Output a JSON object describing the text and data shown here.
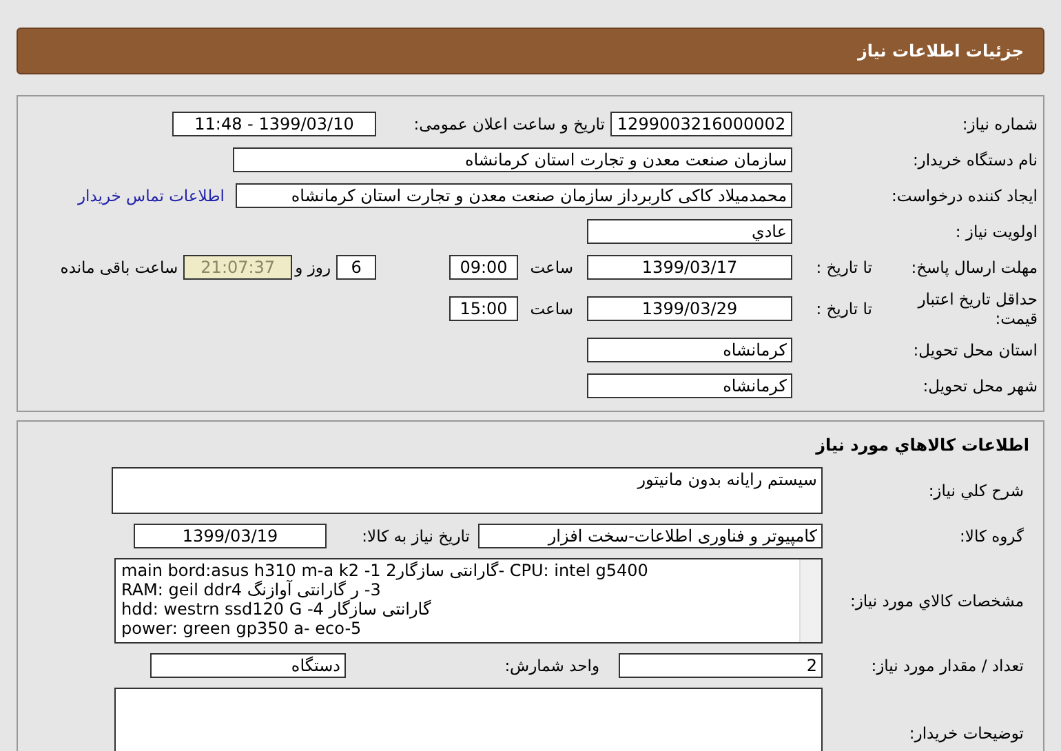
{
  "header": {
    "title": "جزئیات اطلاعات نیاز"
  },
  "details": {
    "need_number": {
      "label": "شماره نیاز:",
      "value": "1299003216000002"
    },
    "announce": {
      "label": "تاریخ و ساعت اعلان عمومی:",
      "value": "1399/03/10 - 11:48"
    },
    "buyer_org": {
      "label": "نام دستگاه خریدار:",
      "value": "سازمان صنعت معدن و تجارت استان کرمانشاه"
    },
    "requester": {
      "label": "ایجاد کننده درخواست:",
      "value": "محمدمیلاد کاکی کاربرداز سازمان صنعت معدن و تجارت استان کرمانشاه",
      "link": "اطلاعات تماس خریدار"
    },
    "priority": {
      "label": "اولویت نیاز :",
      "value": "عادي"
    },
    "deadline": {
      "label": "مهلت ارسال پاسخ:",
      "date_label": "تا تاریخ :",
      "date": "1399/03/17",
      "time_label": "ساعت",
      "time": "09:00",
      "days": "6",
      "days_label": "روز و",
      "remaining": "21:07:37",
      "remaining_label": "ساعت باقی مانده"
    },
    "validity": {
      "label": "حداقل تاریخ اعتبار قیمت:",
      "date_label": "تا تاریخ :",
      "date": "1399/03/29",
      "time_label": "ساعت",
      "time": "15:00"
    },
    "province": {
      "label": "استان محل تحویل:",
      "value": "کرمانشاه"
    },
    "city": {
      "label": "شهر محل تحویل:",
      "value": "کرمانشاه"
    }
  },
  "goods": {
    "title": "اطلاعات کالاهاي مورد نياز",
    "description": {
      "label": "شرح کلي نياز:",
      "value": "سیستم رایانه بدون مانیتور"
    },
    "group": {
      "label": "گروه کالا:",
      "value": "کامپیوتر و فناوری اطلاعات-سخت افزار"
    },
    "need_date": {
      "label": "تاریخ نیاز به کالا:",
      "value": "1399/03/19"
    },
    "specs": {
      "label": "مشخصات کالاي مورد نياز:",
      "lines": [
        "main bord:asus h310 m-a k2 -1 گارانتی سازگار2- CPU: intel g5400",
        "3- ر گارانتی آوازنگ RAM: geil ddr4",
        "hdd: westrn ssd120 G -4 گارانتی سازگار",
        "power: green gp350 a- eco-5"
      ]
    },
    "quantity": {
      "label": "تعداد / مقدار مورد نياز:",
      "value": "2"
    },
    "unit": {
      "label": "واحد شمارش:",
      "value": "دستگاه"
    },
    "notes": {
      "label": "توضیحات خریدار:"
    }
  }
}
